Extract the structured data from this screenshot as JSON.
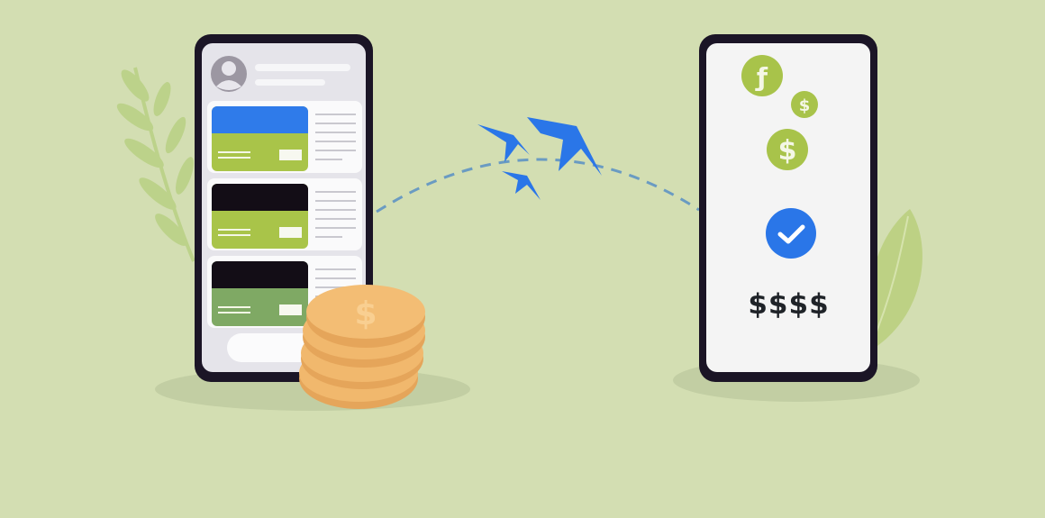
{
  "colors": {
    "background": "#d3deb2",
    "phone_frame": "#1b1526",
    "accent_blue": "#2a76e8",
    "accent_green": "#a8c34a",
    "coin_gold": "#efb567"
  },
  "sender_phone": {
    "cards": [
      {
        "top_color": "#2f7bea",
        "bottom_color": "#a9c449"
      },
      {
        "top_color": "#130d16",
        "bottom_color": "#a9c449"
      },
      {
        "top_color": "#130d16",
        "bottom_color": "#7fa964"
      }
    ]
  },
  "receiver_phone": {
    "coins": [
      {
        "symbol": "ƒ"
      },
      {
        "symbol": "$"
      },
      {
        "symbol": "$"
      }
    ],
    "status_icon": "check-icon",
    "amount": "$$$$"
  },
  "coin_stack": {
    "symbol": "$"
  }
}
